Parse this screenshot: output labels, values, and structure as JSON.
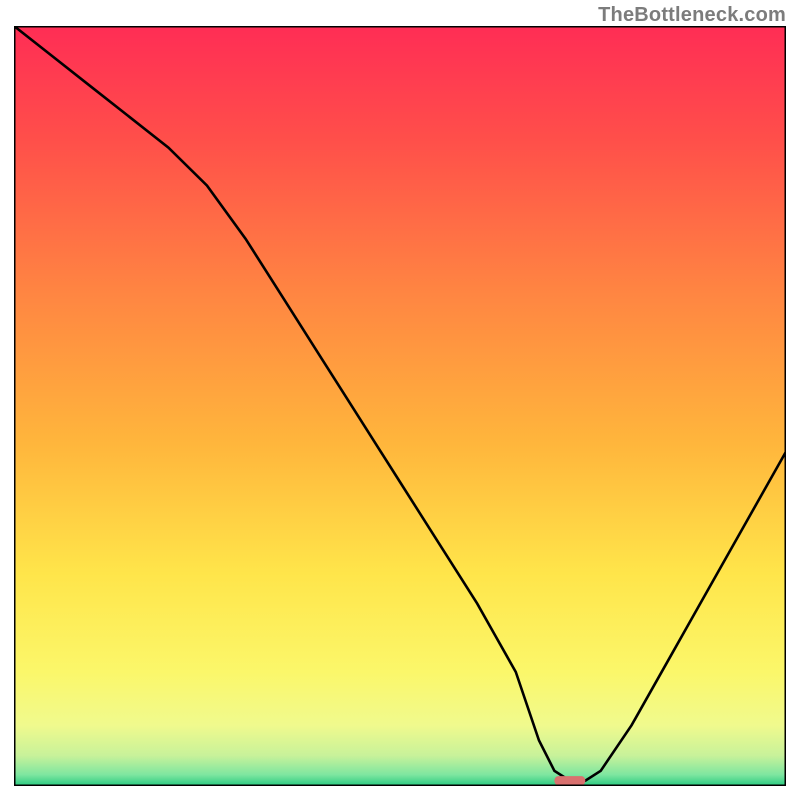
{
  "watermark": "TheBottleneck.com",
  "chart_data": {
    "type": "line",
    "title": "",
    "xlabel": "",
    "ylabel": "",
    "xlim": [
      0,
      100
    ],
    "ylim": [
      0,
      100
    ],
    "x": [
      0,
      5,
      10,
      15,
      20,
      25,
      30,
      35,
      40,
      45,
      50,
      55,
      60,
      65,
      68,
      70,
      72,
      74,
      76,
      80,
      85,
      90,
      95,
      100
    ],
    "values": [
      100,
      96,
      92,
      88,
      84,
      79,
      72,
      64,
      56,
      48,
      40,
      32,
      24,
      15,
      6,
      2,
      0.7,
      0.7,
      2,
      8,
      17,
      26,
      35,
      44
    ],
    "optimal_marker": {
      "x_start": 70,
      "x_end": 74,
      "y": 0.7,
      "color": "#d9716f"
    },
    "background_gradient_stops": [
      {
        "offset": 0.0,
        "color": "#ff2d55"
      },
      {
        "offset": 0.15,
        "color": "#ff4f4a"
      },
      {
        "offset": 0.35,
        "color": "#ff8542"
      },
      {
        "offset": 0.55,
        "color": "#ffb63c"
      },
      {
        "offset": 0.72,
        "color": "#ffe54a"
      },
      {
        "offset": 0.85,
        "color": "#fbf76a"
      },
      {
        "offset": 0.92,
        "color": "#f0fa8d"
      },
      {
        "offset": 0.96,
        "color": "#c8f29a"
      },
      {
        "offset": 0.985,
        "color": "#7fe6a0"
      },
      {
        "offset": 1.0,
        "color": "#28c980"
      }
    ]
  }
}
